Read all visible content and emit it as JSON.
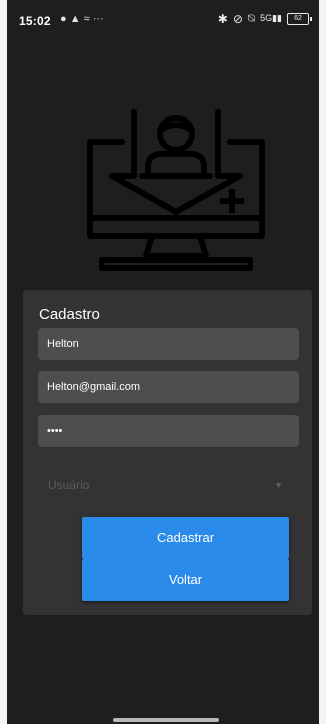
{
  "status_bar": {
    "time": "15:02",
    "left_icons": "● ▲ ≈ ···",
    "right_icons": [
      "bluetooth-icon",
      "link-icon",
      "mute-icon",
      "signal-icon"
    ],
    "signal_text": "5G",
    "battery": "62"
  },
  "hero": {
    "icon": "computer-user-download-icon"
  },
  "form": {
    "title": "Cadastro",
    "name_value": "Helton",
    "email_value": "Helton@gmail.com",
    "password_value": "••••",
    "role_select": {
      "selected": "Usuário",
      "icon": "chevron-down-icon"
    },
    "register_label": "Cadastrar",
    "back_label": "Voltar"
  },
  "colors": {
    "background": "#1e1e1e",
    "card": "#333333",
    "field": "#4e4e4e",
    "primary": "#2b8bea",
    "hero_icon": "#000000"
  }
}
